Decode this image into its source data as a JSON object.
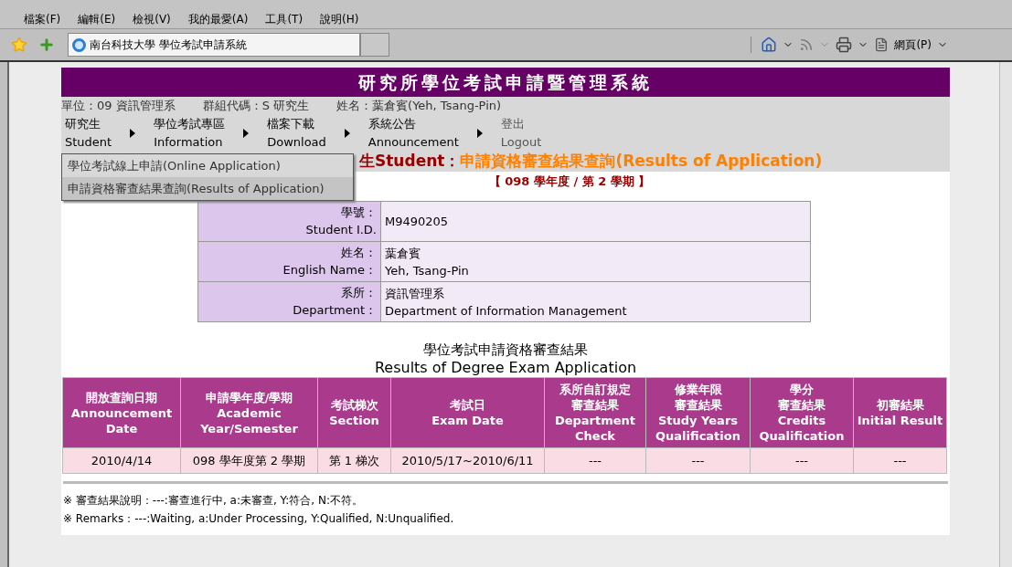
{
  "menu_bar": [
    "檔案(F)",
    "編輯(E)",
    "檢視(V)",
    "我的最愛(A)",
    "工具(T)",
    "說明(H)"
  ],
  "tab": {
    "title": "南台科技大學 學位考試申請系統"
  },
  "command_bar": {
    "page_label": "網頁(P)"
  },
  "page": {
    "title": "研究所學位考試申請暨管理系統",
    "user_info": [
      "單位：09 資訊管理系",
      "群組代碼：S 研究生",
      "姓名：葉倉賓(Yeh, Tsang-Pin)"
    ],
    "nav": [
      {
        "zh": "研究生",
        "en": "Student"
      },
      {
        "zh": "學位考試專區",
        "en": "Information"
      },
      {
        "zh": "檔案下載",
        "en": "Download"
      },
      {
        "zh": "系統公告",
        "en": "Announcement"
      },
      {
        "zh": "登出",
        "en": "Logout"
      }
    ],
    "dropdown": [
      {
        "label": "學位考試線上申請(Online Application)",
        "selected": false
      },
      {
        "label": "申請資格審查結果查詢(Results of Application)",
        "selected": true
      }
    ],
    "heading": {
      "prefix": "生Student：",
      "title": "申請資格審查結果查詢(Results of Application)"
    },
    "term": "【 098 學年度 / 第 2 學期 】",
    "student_info": [
      {
        "label": [
          "學號：",
          "Student I.D."
        ],
        "value": [
          "M9490205"
        ]
      },
      {
        "label": [
          "姓名：",
          "English Name："
        ],
        "value": [
          "葉倉賓",
          "Yeh, Tsang-Pin"
        ]
      },
      {
        "label": [
          "系所：",
          "Department："
        ],
        "value": [
          "資訊管理系",
          "Department of Information Management"
        ]
      }
    ],
    "results_title": [
      "學位考試申請資格審查結果",
      "Results of Degree Exam Application"
    ],
    "table": {
      "columns": [
        {
          "zh": "開放查詢日期",
          "en": "Announcement Date"
        },
        {
          "zh": "申請學年度/學期",
          "en": "Academic Year/Semester"
        },
        {
          "zh": "考試梯次",
          "en": "Section"
        },
        {
          "zh": "考試日",
          "en": "Exam Date"
        },
        {
          "zh": "系所自訂規定",
          "zh_sub": "審查結果",
          "en": "Department Check"
        },
        {
          "zh": "修業年限",
          "zh_sub": "審查結果",
          "en": "Study Years Qualification"
        },
        {
          "zh": "學分",
          "zh_sub": "審查結果",
          "en": "Credits Qualification"
        },
        {
          "zh": "初審結果",
          "en": "Initial Result"
        }
      ],
      "rows": [
        [
          "2010/4/14",
          "098 學年度第 2 學期",
          "第 1 梯次",
          "2010/5/17~2010/6/11",
          "---",
          "---",
          "---",
          "---"
        ]
      ]
    },
    "notes": [
      "※ 審查結果說明：---:審查進行中, a:未審查, Y:符合, N:不符。",
      "※ Remarks：---:Waiting, a:Under Processing, Y:Qualified, N:Unqualified."
    ]
  }
}
